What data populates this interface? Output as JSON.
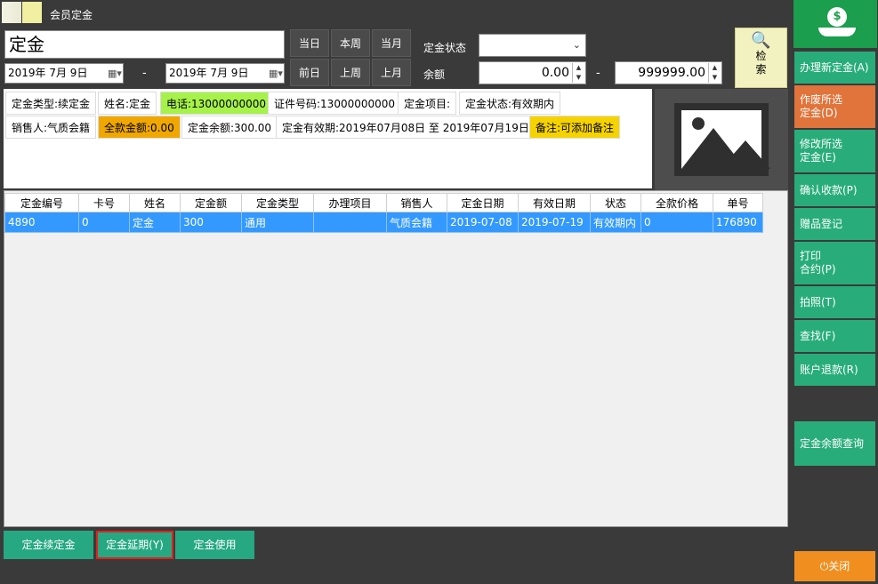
{
  "window": {
    "title": "会员定金"
  },
  "search": {
    "name_value": "定金",
    "date_from": "2019年  7月  9日",
    "date_to": "2019年  7月  9日",
    "dash": "-",
    "quick_buttons": [
      "当日",
      "本周",
      "当月",
      "前日",
      "上周",
      "上月"
    ],
    "status_label": "定金状态",
    "status_value": "",
    "balance_label": "余额",
    "balance_min": "0.00",
    "balance_max": "999999.00",
    "search_button": "检索"
  },
  "info": {
    "deposit_type": "定金类型:续定金",
    "name": "姓名:定金",
    "phone": "电话:13000000000",
    "id_number": "证件号码:13000000000",
    "deposit_item": "定金项目:",
    "deposit_status": "定金状态:有效期内",
    "salesperson": "销售人:气质会籍",
    "full_amount": "全款金额:0.00",
    "deposit_balance": "定金余额:300.00",
    "valid_period": "定金有效期:2019年07月08日 至 2019年07月19日",
    "remark": "备注:可添加备注"
  },
  "table": {
    "headers": [
      "定金编号",
      "卡号",
      "姓名",
      "定金额",
      "定金类型",
      "办理项目",
      "销售人",
      "定金日期",
      "有效日期",
      "状态",
      "全款价格",
      "单号"
    ],
    "rows": [
      [
        "4890",
        "0",
        "定金",
        "300",
        "通用",
        "",
        "气质会籍",
        "2019-07-08",
        "2019-07-19",
        "有效期内",
        "0",
        "176890"
      ]
    ]
  },
  "bottom_buttons": {
    "renew": "定金续定金",
    "extend": "定金延期(Y)",
    "use": "定金使用"
  },
  "sidebar": {
    "items": [
      "办理新定金(A)",
      "作废所选\n定金(D)",
      "修改所选\n定金(E)",
      "确认收款(P)",
      "赠品登记",
      "打印\n合约(P)",
      "拍照(T)",
      "查找(F)",
      "账户退款(R)",
      "定金余额查询"
    ],
    "close": "关闭"
  },
  "colors": {
    "accent_green": "#28ad7a",
    "selected_row": "#3399ff",
    "orange_button": "#e0743b",
    "close_button": "#f08f1f",
    "phone_tag": "#a6f24a",
    "amount_tag": "#f0a800",
    "remark_tag": "#f5d300",
    "highlight_border": "#e2221f"
  }
}
